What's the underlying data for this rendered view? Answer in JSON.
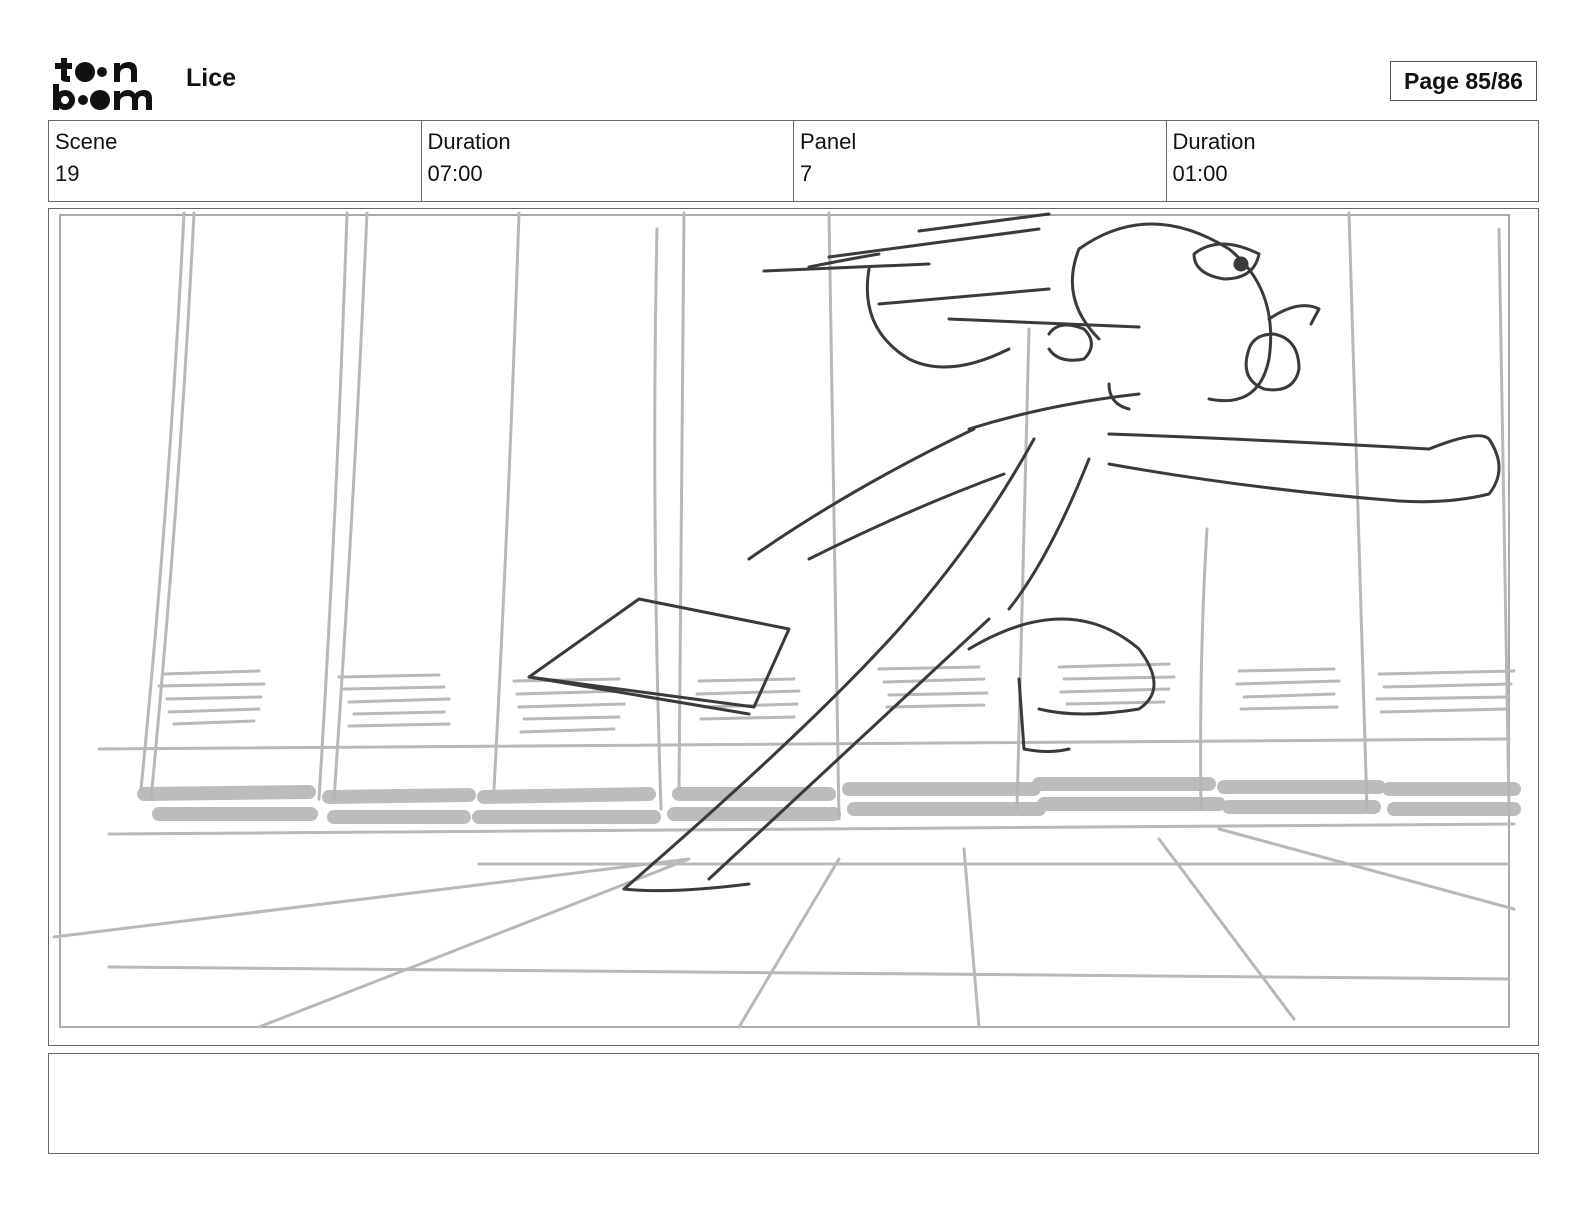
{
  "header": {
    "logo_text": "toon boom",
    "project_title": "Lice",
    "page_label": "Page 85/86"
  },
  "info": [
    {
      "label": "Scene",
      "value": "19"
    },
    {
      "label": "Duration",
      "value": "07:00"
    },
    {
      "label": "Panel",
      "value": "7"
    },
    {
      "label": "Duration",
      "value": "01:00"
    }
  ],
  "panel": {
    "image_description": "Rough sketch of a girl running through a school hallway past lockers, carrying a book"
  },
  "notes": {
    "text": ""
  }
}
